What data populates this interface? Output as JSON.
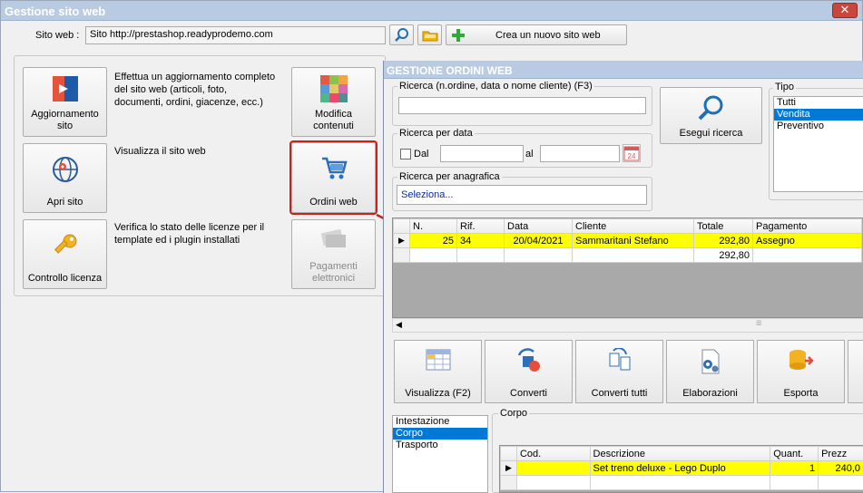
{
  "window": {
    "title": "Gestione sito web"
  },
  "site": {
    "label": "Sito web :",
    "value": "Sito http://prestashop.readyprodemo.com"
  },
  "top_buttons": {
    "create_site": "Crea un nuovo sito web"
  },
  "actions": [
    {
      "label": "Aggiornamento sito",
      "line1": "Aggiornamento",
      "line2": "sito",
      "description": "Effettua un aggiornamento completo del sito web (articoli, foto, documenti, ordini, giacenze, ecc.)",
      "d1": "Effettua un aggiornamento completo",
      "d2": "del sito web (articoli, foto,",
      "d3": "documenti, ordini, giacenze, ecc.)"
    },
    {
      "label": "Apri sito",
      "description": "Visualizza il sito web"
    },
    {
      "label": "Controllo licenza",
      "d1": "Verifica lo stato delle licenze per il",
      "d2": "template ed i plugin installati"
    }
  ],
  "side_buttons": {
    "modifica": {
      "line1": "Modifica",
      "line2": "contenuti"
    },
    "ordini": {
      "label": "Ordini web"
    },
    "pagamenti": {
      "line1": "Pagamenti",
      "line2": "elettronici"
    }
  },
  "dialog": {
    "title": "GESTIONE ORDINI WEB",
    "ricerca": {
      "label": "Ricerca (n.ordine, data o nome cliente) (F3)",
      "value": ""
    },
    "ricerca_data": {
      "label": "Ricerca per data",
      "dal": "Dal",
      "al": "al",
      "cal_day": "24"
    },
    "ricerca_anagrafica": {
      "label": "Ricerca per anagrafica",
      "value": "Seleziona..."
    },
    "esegui": "Esegui ricerca",
    "tipo": {
      "label": "Tipo",
      "items": [
        "Tutti",
        "Vendita",
        "Preventivo"
      ],
      "selected": 1
    },
    "orders": {
      "columns": [
        "N.",
        "Rif.",
        "Data",
        "Cliente",
        "Totale",
        "Pagamento"
      ],
      "rows": [
        {
          "n": "25",
          "rif": "34",
          "data": "20/04/2021",
          "cliente": "Sammaritani Stefano",
          "totale": "292,80",
          "pagamento": "Assegno"
        }
      ],
      "footer_total": "292,80"
    },
    "toolbar": [
      "Visualizza (F2)",
      "Converti",
      "Converti tutti",
      "Elaborazioni",
      "Esporta"
    ],
    "sections": {
      "items": [
        "Intestazione",
        "Corpo",
        "Trasporto"
      ],
      "selected": 1
    },
    "corpo": {
      "label": "Corpo",
      "columns": [
        "Cod.",
        "Descrizione",
        "Quant.",
        "Prezz"
      ],
      "rows": [
        {
          "cod": "",
          "descrizione": "Set treno deluxe - Lego Duplo",
          "quant": "1",
          "prezzo": "240,0"
        }
      ]
    }
  },
  "colors": {
    "accent_red": "#cc1f1f",
    "highlight": "#ffff00",
    "selection": "#0078d7",
    "titlebar": "#b9cbe2"
  }
}
